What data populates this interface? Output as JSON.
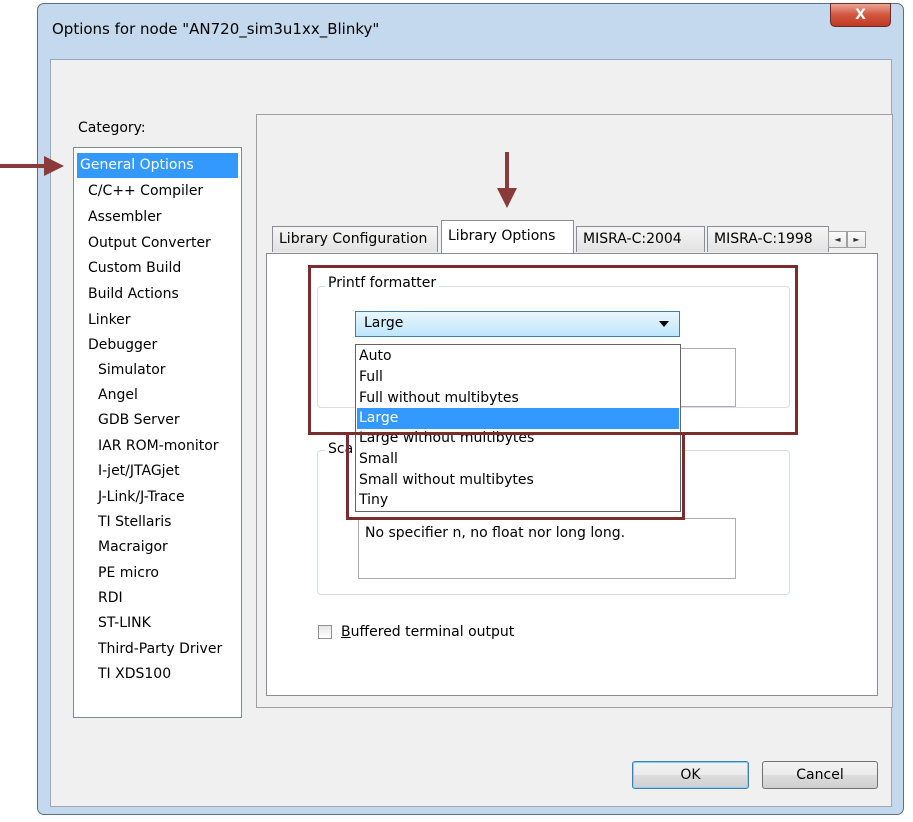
{
  "window": {
    "title": "Options for node \"AN720_sim3u1xx_Blinky\"",
    "close_symbol": "X"
  },
  "category": {
    "label": "Category:",
    "items": [
      {
        "label": "General Options",
        "selected": true
      },
      {
        "label": "C/C++ Compiler"
      },
      {
        "label": "Assembler"
      },
      {
        "label": "Output Converter"
      },
      {
        "label": "Custom Build"
      },
      {
        "label": "Build Actions"
      },
      {
        "label": "Linker"
      },
      {
        "label": "Debugger"
      },
      {
        "label": "Simulator"
      },
      {
        "label": "Angel"
      },
      {
        "label": "GDB Server"
      },
      {
        "label": "IAR ROM-monitor"
      },
      {
        "label": "I-jet/JTAGjet"
      },
      {
        "label": "J-Link/J-Trace"
      },
      {
        "label": "TI Stellaris"
      },
      {
        "label": "Macraigor"
      },
      {
        "label": "PE micro"
      },
      {
        "label": "RDI"
      },
      {
        "label": "ST-LINK"
      },
      {
        "label": "Third-Party Driver"
      },
      {
        "label": "TI XDS100"
      }
    ]
  },
  "tabs": [
    {
      "label": "Library Configuration"
    },
    {
      "label": "Library Options",
      "active": true
    },
    {
      "label": "MISRA-C:2004"
    },
    {
      "label": "MISRA-C:1998"
    }
  ],
  "tab_scroll": {
    "left": "◄",
    "right": "►"
  },
  "printf": {
    "group_label": "Printf formatter",
    "selected": "Large",
    "options": [
      "Auto",
      "Full",
      "Full without multibytes",
      "Large",
      "Large without multibytes",
      "Small",
      "Small without multibytes",
      "Tiny"
    ]
  },
  "scanf": {
    "group_label_partial": "Sca",
    "description": "No specifier n, no float nor long long."
  },
  "buffered": {
    "label_underlined": "B",
    "label_rest": "uffered terminal output",
    "checked": false
  },
  "buttons": {
    "ok": "OK",
    "cancel": "Cancel"
  },
  "colors": {
    "selection": "#3399ff",
    "annotation": "#7b2c2c",
    "frame": "#c4d9ee"
  }
}
